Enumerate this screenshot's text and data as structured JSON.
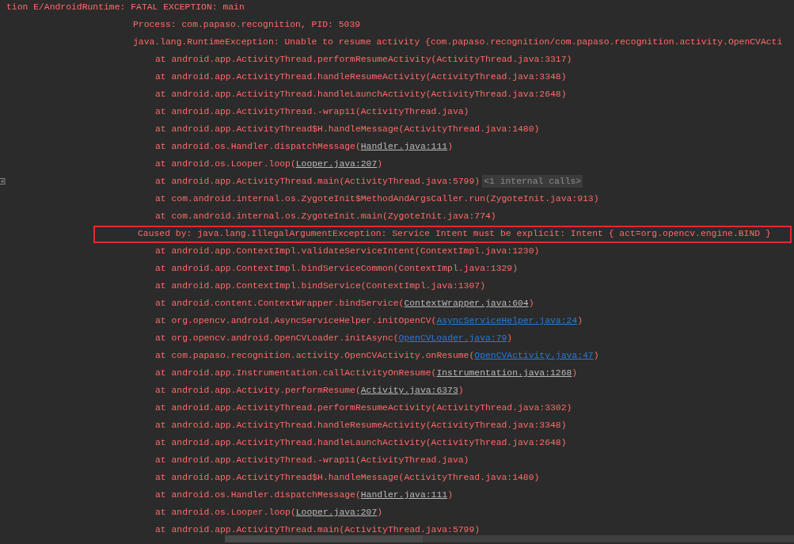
{
  "log": {
    "lines": [
      {
        "kind": "header",
        "segments": [
          {
            "kind": "text",
            "text": "tion E/AndroidRuntime: FATAL EXCEPTION: main"
          }
        ]
      },
      {
        "kind": "process",
        "segments": [
          {
            "kind": "text",
            "text": "Process: com.papaso.recognition, PID: 5039"
          }
        ]
      },
      {
        "kind": "process",
        "segments": [
          {
            "kind": "text",
            "text": "java.lang.RuntimeException: Unable to resume activity {com.papaso.recognition/com.papaso.recognition.activity.OpenCVActi"
          }
        ]
      },
      {
        "kind": "frame",
        "segments": [
          {
            "kind": "text",
            "text": "at android.app.ActivityThread.performResumeActivity(ActivityThread.java:3317)"
          }
        ]
      },
      {
        "kind": "frame",
        "segments": [
          {
            "kind": "text",
            "text": "at android.app.ActivityThread.handleResumeActivity(ActivityThread.java:3348)"
          }
        ]
      },
      {
        "kind": "frame",
        "segments": [
          {
            "kind": "text",
            "text": "at android.app.ActivityThread.handleLaunchActivity(ActivityThread.java:2648)"
          }
        ]
      },
      {
        "kind": "frame",
        "segments": [
          {
            "kind": "text",
            "text": "at android.app.ActivityThread.-wrap11(ActivityThread.java)"
          }
        ]
      },
      {
        "kind": "frame",
        "segments": [
          {
            "kind": "text",
            "text": "at android.app.ActivityThread$H.handleMessage(ActivityThread.java:1480)"
          }
        ]
      },
      {
        "kind": "frame",
        "segments": [
          {
            "kind": "text",
            "text": "at android.os.Handler.dispatchMessage("
          },
          {
            "kind": "file",
            "text": "Handler.java:111"
          },
          {
            "kind": "text",
            "text": ")"
          }
        ]
      },
      {
        "kind": "frame",
        "segments": [
          {
            "kind": "text",
            "text": "at android.os.Looper.loop("
          },
          {
            "kind": "file",
            "text": "Looper.java:207"
          },
          {
            "kind": "text",
            "text": ")"
          }
        ]
      },
      {
        "kind": "frame",
        "segments": [
          {
            "kind": "text",
            "text": "at android.app.ActivityThread.main(ActivityThread.java:5799)"
          },
          {
            "kind": "folded",
            "text": "<1 internal calls>"
          }
        ]
      },
      {
        "kind": "frame",
        "segments": [
          {
            "kind": "text",
            "text": "at com.android.internal.os.ZygoteInit$MethodAndArgsCaller.run(ZygoteInit.java:913)"
          }
        ]
      },
      {
        "kind": "frame",
        "segments": [
          {
            "kind": "text",
            "text": "at com.android.internal.os.ZygoteInit.main(ZygoteInit.java:774)"
          }
        ]
      },
      {
        "kind": "cause",
        "segments": [
          {
            "kind": "text",
            "text": "Caused by: java.lang.IllegalArgumentException: Service Intent must be explicit: Intent { act=org.opencv.engine.BIND }"
          }
        ]
      },
      {
        "kind": "frame",
        "segments": [
          {
            "kind": "text",
            "text": "at android.app.ContextImpl.validateServiceIntent(ContextImpl.java:1230)"
          }
        ]
      },
      {
        "kind": "frame",
        "segments": [
          {
            "kind": "text",
            "text": "at android.app.ContextImpl.bindServiceCommon(ContextImpl.java:1329)"
          }
        ]
      },
      {
        "kind": "frame",
        "segments": [
          {
            "kind": "text",
            "text": "at android.app.ContextImpl.bindService(ContextImpl.java:1307)"
          }
        ]
      },
      {
        "kind": "frame",
        "segments": [
          {
            "kind": "text",
            "text": "at android.content.ContextWrapper.bindService("
          },
          {
            "kind": "file",
            "text": "ContextWrapper.java:604"
          },
          {
            "kind": "text",
            "text": ")"
          }
        ]
      },
      {
        "kind": "frame",
        "segments": [
          {
            "kind": "text",
            "text": "at org.opencv.android.AsyncServiceHelper.initOpenCV("
          },
          {
            "kind": "source",
            "text": "AsyncServiceHelper.java:24"
          },
          {
            "kind": "text",
            "text": ")"
          }
        ]
      },
      {
        "kind": "frame",
        "segments": [
          {
            "kind": "text",
            "text": "at org.opencv.android.OpenCVLoader.initAsync("
          },
          {
            "kind": "source",
            "text": "OpenCVLoader.java:79"
          },
          {
            "kind": "text",
            "text": ")"
          }
        ]
      },
      {
        "kind": "frame",
        "segments": [
          {
            "kind": "text",
            "text": "at com.papaso.recognition.activity.OpenCVActivity.onResume("
          },
          {
            "kind": "source",
            "text": "OpenCVActivity.java:47"
          },
          {
            "kind": "text",
            "text": ")"
          }
        ]
      },
      {
        "kind": "frame",
        "segments": [
          {
            "kind": "text",
            "text": "at android.app.Instrumentation.callActivityOnResume("
          },
          {
            "kind": "file",
            "text": "Instrumentation.java:1268"
          },
          {
            "kind": "text",
            "text": ")"
          }
        ]
      },
      {
        "kind": "frame",
        "segments": [
          {
            "kind": "text",
            "text": "at android.app.Activity.performResume("
          },
          {
            "kind": "file",
            "text": "Activity.java:6373"
          },
          {
            "kind": "text",
            "text": ")"
          }
        ]
      },
      {
        "kind": "frame",
        "segments": [
          {
            "kind": "text",
            "text": "at android.app.ActivityThread.performResumeActivity(ActivityThread.java:3302)"
          }
        ]
      },
      {
        "kind": "frame",
        "segments": [
          {
            "kind": "text",
            "text": "at android.app.ActivityThread.handleResumeActivity(ActivityThread.java:3348)"
          }
        ]
      },
      {
        "kind": "frame",
        "segments": [
          {
            "kind": "text",
            "text": "at android.app.ActivityThread.handleLaunchActivity(ActivityThread.java:2648)"
          }
        ]
      },
      {
        "kind": "frame",
        "segments": [
          {
            "kind": "text",
            "text": "at android.app.ActivityThread.-wrap11(ActivityThread.java)"
          }
        ]
      },
      {
        "kind": "frame",
        "segments": [
          {
            "kind": "text",
            "text": "at android.app.ActivityThread$H.handleMessage(ActivityThread.java:1480)"
          }
        ]
      },
      {
        "kind": "frame",
        "segments": [
          {
            "kind": "text",
            "text": "at android.os.Handler.dispatchMessage("
          },
          {
            "kind": "file",
            "text": "Handler.java:111"
          },
          {
            "kind": "text",
            "text": ")"
          }
        ]
      },
      {
        "kind": "frame",
        "segments": [
          {
            "kind": "text",
            "text": "at android.os.Looper.loop("
          },
          {
            "kind": "file",
            "text": "Looper.java:207"
          },
          {
            "kind": "text",
            "text": ")"
          }
        ]
      },
      {
        "kind": "frame",
        "segments": [
          {
            "kind": "text",
            "text": "at android.app.ActivityThread.main(ActivityThread.java:5799)"
          }
        ]
      }
    ]
  }
}
